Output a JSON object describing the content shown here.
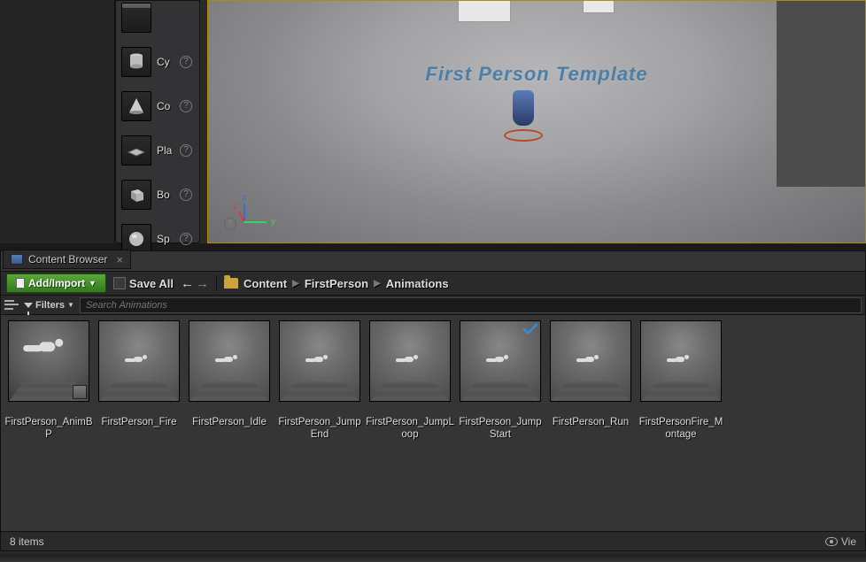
{
  "palette": {
    "items": [
      {
        "label": "Cy"
      },
      {
        "label": "Co"
      },
      {
        "label": "Pla"
      },
      {
        "label": "Bo"
      },
      {
        "label": "Sp"
      }
    ]
  },
  "viewport": {
    "floor_text": "First Person Template"
  },
  "content_browser": {
    "tab_title": "Content Browser",
    "add_import_label": "Add/Import",
    "save_all_label": "Save All",
    "breadcrumb": [
      "Content",
      "FirstPerson",
      "Animations"
    ],
    "filters_label": "Filters",
    "search_placeholder": "Search Animations",
    "assets": [
      {
        "name": "FirstPerson_AnimBP",
        "kind": "animbp"
      },
      {
        "name": "FirstPerson_Fire",
        "kind": "anim"
      },
      {
        "name": "FirstPerson_Idle",
        "kind": "anim"
      },
      {
        "name": "FirstPerson_JumpEnd",
        "kind": "anim"
      },
      {
        "name": "FirstPerson_JumpLoop",
        "kind": "anim"
      },
      {
        "name": "FirstPerson_JumpStart",
        "kind": "anim",
        "checked": true
      },
      {
        "name": "FirstPerson_Run",
        "kind": "anim"
      },
      {
        "name": "FirstPersonFire_Montage",
        "kind": "anim"
      }
    ],
    "item_count_label": "8 items",
    "view_options_label": "Vie"
  }
}
